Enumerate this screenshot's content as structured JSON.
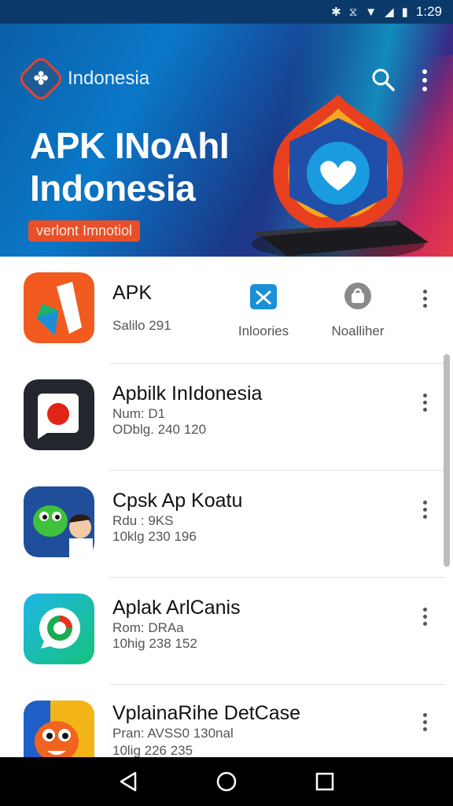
{
  "status_bar": {
    "time": "1:29",
    "icons": [
      "bluetooth-icon",
      "vibrate-icon",
      "wifi-icon",
      "signal-icon",
      "battery-icon"
    ]
  },
  "header": {
    "brand_name": "Indonesia",
    "title_line1": "APK INoAhI",
    "title_line2": "Indonesia",
    "pill": "verlont Imnotiol"
  },
  "featured": {
    "title": "APK",
    "meta": "Salilo   291",
    "categories": [
      {
        "label": "Inloories",
        "icon": "picture-icon",
        "color": "#1a8fd8"
      },
      {
        "label": "Noalliher",
        "icon": "bag-icon",
        "color": "#8a8a8a"
      }
    ]
  },
  "apps": [
    {
      "title": "Apbilk InIdonesia",
      "meta1": "Num: D1",
      "meta2": "ODblg. 240  120",
      "icon": "camera-icon"
    },
    {
      "title": "Cpsk Ap Koatu",
      "meta1": "Rdu : 9KS",
      "meta2": "10klg  230  196",
      "icon": "mascot-icon"
    },
    {
      "title": "Aplak ArlCanis",
      "meta1": "Rom: DRAa",
      "meta2": "10hig  238  152",
      "icon": "chat-icon"
    },
    {
      "title": "VplainaRihe DetCase",
      "meta1": "Pran:  AVSS0  130nal",
      "meta2": "10lig  226  235",
      "icon": "fox-icon"
    }
  ],
  "colors": {
    "accent": "#e8502a",
    "header_blue": "#0a78c8"
  }
}
